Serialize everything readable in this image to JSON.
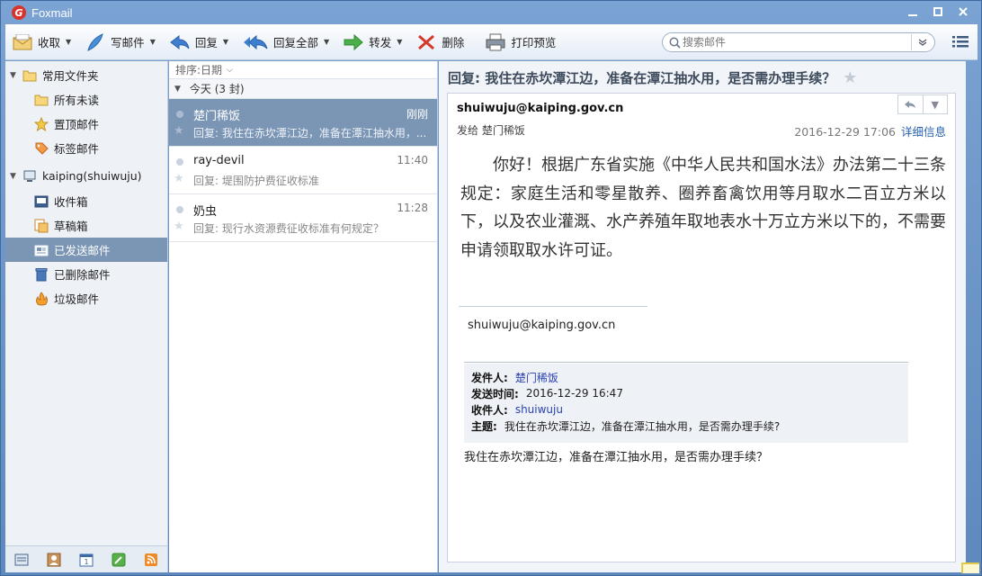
{
  "window": {
    "title": "Foxmail",
    "logo_letter": "G"
  },
  "toolbar": {
    "receive": "收取",
    "compose": "写邮件",
    "reply": "回复",
    "reply_all": "回复全部",
    "forward": "转发",
    "delete": "删除",
    "print_preview": "打印预览"
  },
  "search": {
    "placeholder": "搜索邮件"
  },
  "sidebar": {
    "common_folder": "常用文件夹",
    "common_items": [
      "所有未读",
      "置顶邮件",
      "标签邮件"
    ],
    "account": "kaiping(shuiwuju)",
    "account_items": [
      "收件箱",
      "草稿箱",
      "已发送邮件",
      "已删除邮件",
      "垃圾邮件"
    ],
    "selected": "已发送邮件"
  },
  "maillist": {
    "sort_label": "排序:日期",
    "group_label": "今天 (3 封)",
    "items": [
      {
        "sender": "楚门稀饭",
        "time": "刚刚",
        "subject": "回复: 我住在赤坎潭江边，准备在潭江抽水用，..."
      },
      {
        "sender": "ray-devil",
        "time": "11:40",
        "subject": "回复: 堤围防护费征收标准"
      },
      {
        "sender": "奶虫",
        "time": "11:28",
        "subject": "回复: 现行水资源费征收标准有何规定？"
      }
    ]
  },
  "reader": {
    "title": "回复: 我住在赤坎潭江边，准备在潭江抽水用，是否需办理手续？",
    "from": "shuiwuju@kaiping.gov.cn",
    "to": "发给 楚门稀饭",
    "date": "2016-12-29 17:06",
    "details_link": "详细信息",
    "body": "你好！根据广东省实施《中华人民共和国水法》办法第二十三条规定：家庭生活和零星散养、圈养畜禽饮用等月取水二百立方米以下，以及农业灌溉、水产养殖年取地表水十万立方米以下的，不需要申请领取取水许可证。",
    "signature": "shuiwuju@kaiping.gov.cn",
    "quote": {
      "sender_label": "发件人:",
      "sender": "楚门稀饭",
      "time_label": "发送时间:",
      "time": "2016-12-29 16:47",
      "to_label": "收件人:",
      "to": "shuiwuju",
      "subject_label": "主题:",
      "subject": "我住在赤坎潭江边，准备在潭江抽水用，是否需办理手续?"
    },
    "quote_body": "我住在赤坎潭江边，准备在潭江抽水用，是否需办理手续？"
  },
  "colors": {
    "accent": "#7b95b5",
    "frame": "#5f89bd",
    "link": "#2a62b0"
  }
}
